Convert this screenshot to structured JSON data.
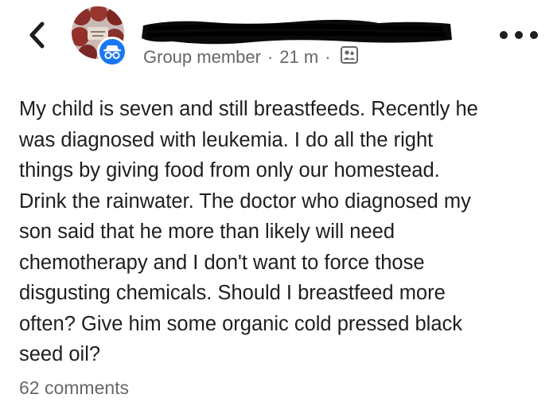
{
  "header": {
    "back_icon": "chevron-left-icon",
    "author_name": "",
    "role": "Group member",
    "separator": "·",
    "time": "21 m",
    "audience_icon": "group-icon",
    "more_icon": "more-horizontal-icon"
  },
  "post": {
    "text": "My child is seven and still breastfeeds. Recently he\nwas diagnosed with leukemia. I do all the right\nthings by giving food from only our homestead.\nDrink the rainwater. The doctor who diagnosed my\nson said that he more than likely will need\nchemotherapy and I don't want to force those\ndisgusting chemicals. Should I breastfeed more\noften? Give him some organic cold pressed black\nseed oil?"
  },
  "footer": {
    "comments": "62 comments"
  },
  "colors": {
    "text": "#1c1e21",
    "secondary": "#65676b",
    "anon_badge": "#1877f2",
    "redaction": "#0a0a0a"
  }
}
